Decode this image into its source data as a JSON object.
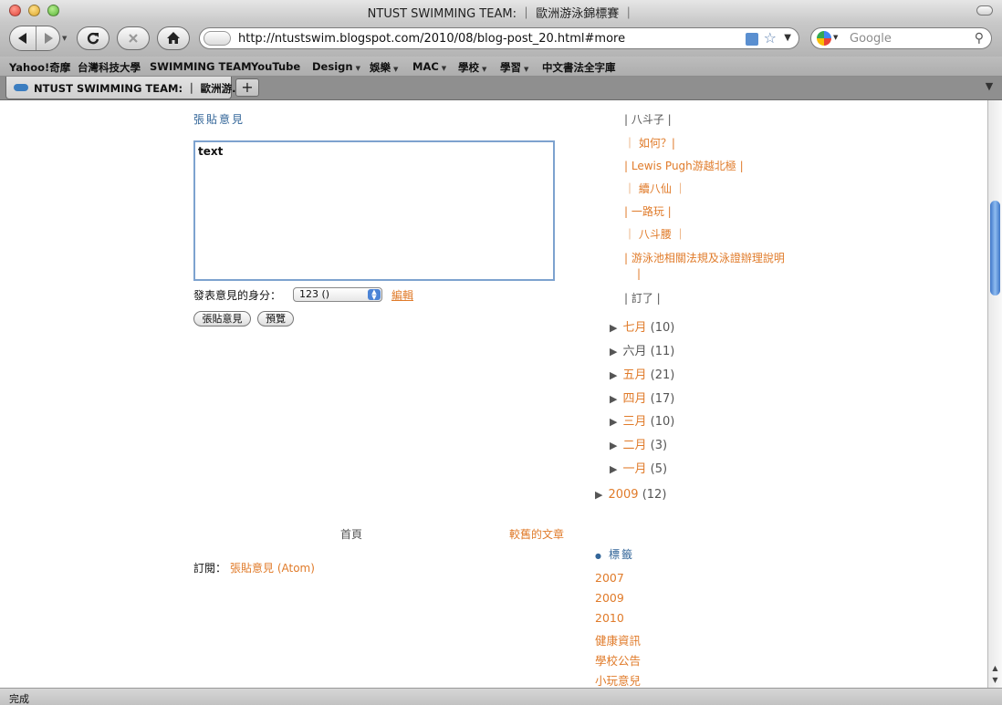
{
  "window": {
    "title": "NTUST SWIMMING TEAM: ｜ 歐洲游泳錦標賽 ｜"
  },
  "toolbar": {
    "url": "http://ntustswim.blogspot.com/2010/08/blog-post_20.html#more",
    "search_placeholder": "Google"
  },
  "bookmarks": [
    {
      "label": "Yahoo!奇摩",
      "has_menu": false
    },
    {
      "label": "台灣科技大學",
      "has_menu": false
    },
    {
      "label": "SWIMMING TEAM",
      "has_menu": false
    },
    {
      "label": "YouTube",
      "has_menu": false
    },
    {
      "label": "Design",
      "has_menu": true
    },
    {
      "label": "娛樂",
      "has_menu": true
    },
    {
      "label": "MAC",
      "has_menu": true
    },
    {
      "label": "學校",
      "has_menu": true
    },
    {
      "label": "學習",
      "has_menu": true
    },
    {
      "label": "中文書法全字庫",
      "has_menu": false
    }
  ],
  "tab": {
    "title": "NTUST SWIMMING TEAM: ｜ 歐洲游..."
  },
  "comment_form": {
    "heading": "張貼意見",
    "textarea_value": "text",
    "identity_label": "發表意見的身分：",
    "identity_value": "123 ()",
    "edit_link": "編輯",
    "post_button": "張貼意見",
    "preview_button": "預覽"
  },
  "pager": {
    "home": "首頁",
    "older": "較舊的文章"
  },
  "subscribe": {
    "label": "訂閱：",
    "link": "張貼意見 (Atom)"
  },
  "archive": {
    "posts": [
      {
        "title": "| 八斗子 |",
        "color": "gray"
      },
      {
        "title": "｜ 如何？|",
        "color": "orange"
      },
      {
        "title": "| Lewis Pugh游越北極 |",
        "color": "orange"
      },
      {
        "title": "｜ 續八仙 ｜",
        "color": "orange"
      },
      {
        "title": "| 一路玩 |",
        "color": "orange"
      },
      {
        "title": "｜ 八斗腰 ｜",
        "color": "orange"
      },
      {
        "title": "| 游泳池相關法規及泳證辦理說明",
        "color": "orange"
      },
      {
        "title": "|",
        "color": "orange"
      },
      {
        "title": "| 訂了 |",
        "color": "gray"
      }
    ],
    "months": [
      {
        "name": "七月",
        "count": "(10)",
        "color": "orange"
      },
      {
        "name": "六月",
        "count": "(11)",
        "color": "gray"
      },
      {
        "name": "五月",
        "count": "(21)",
        "color": "orange"
      },
      {
        "name": "四月",
        "count": "(17)",
        "color": "orange"
      },
      {
        "name": "三月",
        "count": "(10)",
        "color": "orange"
      },
      {
        "name": "二月",
        "count": "(3)",
        "color": "orange"
      },
      {
        "name": "一月",
        "count": "(5)",
        "color": "orange"
      }
    ],
    "year": {
      "name": "2009",
      "count": "(12)"
    }
  },
  "labels": {
    "heading": "標籤",
    "items": [
      "2007",
      "2009",
      "2010",
      "健康資訊",
      "學校公告",
      "小玩意兒"
    ]
  },
  "status": {
    "text": "完成"
  },
  "colors": {
    "accent": "#e07b2a",
    "link_blue": "#336699",
    "scroll_thumb": "#3f77c8"
  }
}
